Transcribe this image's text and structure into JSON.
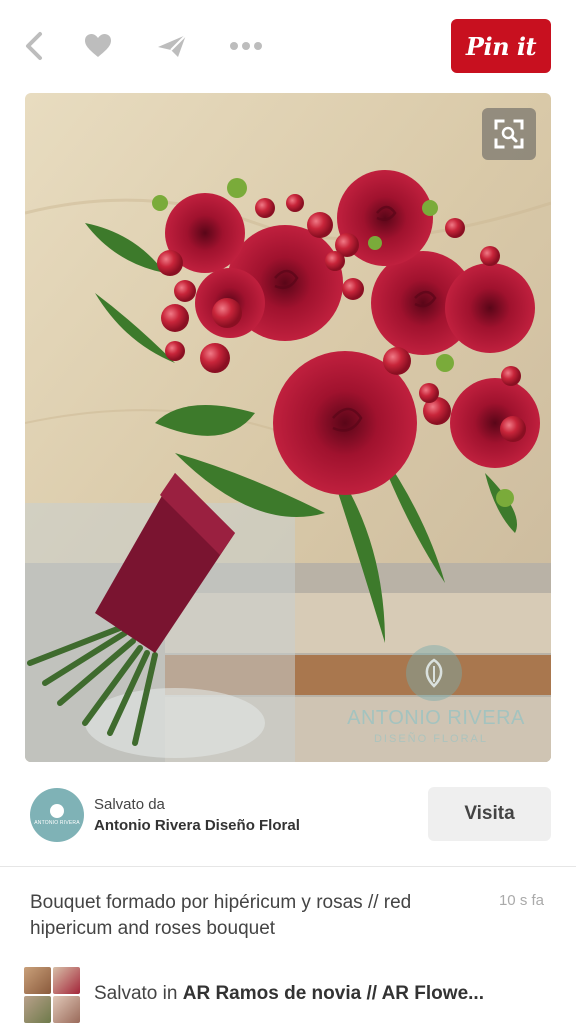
{
  "topbar": {
    "back_icon": "chevron-left-icon",
    "like_icon": "heart-icon",
    "send_icon": "send-icon",
    "more_icon": "more-dots-icon",
    "pin_label": "Pin it",
    "pin_color": "#c8101f"
  },
  "image": {
    "description": "Bridal bouquet of red roses and red hypericum berries with wrapped stems",
    "zoom_icon": "visual-search-icon",
    "watermark_name": "ANTONIO RIVERA",
    "watermark_sub": "DISEÑO FLORAL"
  },
  "source": {
    "avatar_text": "ANTONIO RIVERA",
    "saved_by_label": "Salvato da",
    "name": "Antonio Rivera Diseño Floral",
    "visit_label": "Visita"
  },
  "description": {
    "text": "Bouquet formado por hipéricum y rosas // red hipericum and roses bouquet",
    "time": "10 s fa"
  },
  "board": {
    "prefix": "Salvato in ",
    "name": "AR Ramos de novia // AR Flowe..."
  }
}
